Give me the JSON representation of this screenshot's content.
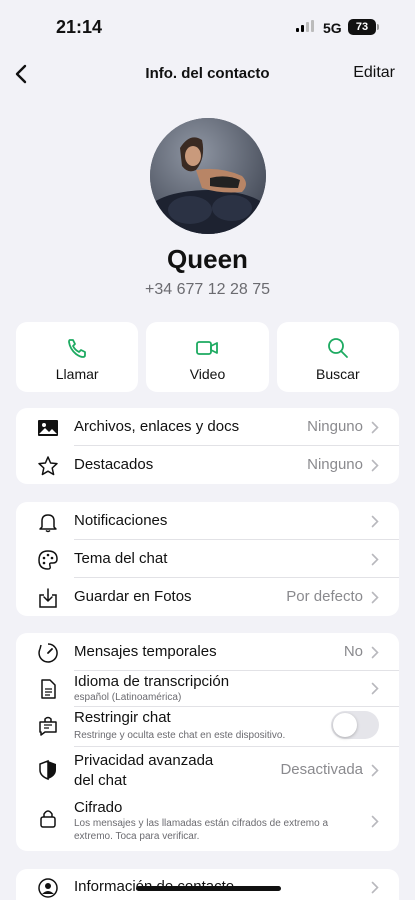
{
  "status": {
    "time": "21:14",
    "network": "5G",
    "battery": "73"
  },
  "nav": {
    "title": "Info. del contacto",
    "edit": "Editar"
  },
  "profile": {
    "name": "Queen",
    "phone": "+34 677 12 28 75"
  },
  "actions": [
    {
      "label": "Llamar",
      "icon": "phone-icon"
    },
    {
      "label": "Video",
      "icon": "video-icon"
    },
    {
      "label": "Buscar",
      "icon": "search-icon"
    }
  ],
  "accent_color": "#1daa61",
  "media_card": [
    {
      "label": "Archivos, enlaces y docs",
      "value": "Ninguno",
      "icon": "image-icon"
    },
    {
      "label": "Destacados",
      "value": "Ninguno",
      "icon": "star-icon"
    }
  ],
  "settings_card": [
    {
      "label": "Notificaciones",
      "value": "",
      "icon": "bell-icon"
    },
    {
      "label": "Tema del chat",
      "value": "",
      "icon": "palette-icon"
    },
    {
      "label": "Guardar en Fotos",
      "value": "Por defecto",
      "icon": "download-icon"
    }
  ],
  "privacy_card": {
    "temporales": {
      "label": "Mensajes temporales",
      "value": "No",
      "icon": "timer-icon"
    },
    "idioma": {
      "label": "Idioma de transcripción",
      "sub": "español (Latinoamérica)",
      "icon": "document-icon"
    },
    "restringir": {
      "label": "Restringir chat",
      "sub": "Restringe y oculta este chat en este dispositivo.",
      "icon": "restrict-chat-icon",
      "enabled": false
    },
    "privacidad": {
      "label_line1": "Privacidad avanzada",
      "label_line2": "del chat",
      "value": "Desactivada",
      "icon": "shield-icon"
    },
    "cifrado": {
      "label": "Cifrado",
      "sub_line1": "Los mensajes y las llamadas están cifrados de extremo a",
      "sub_line2": "extremo. Toca para verificar.",
      "icon": "lock-icon"
    }
  },
  "contact_card": {
    "label": "Información de contacto",
    "icon": "contact-icon"
  }
}
